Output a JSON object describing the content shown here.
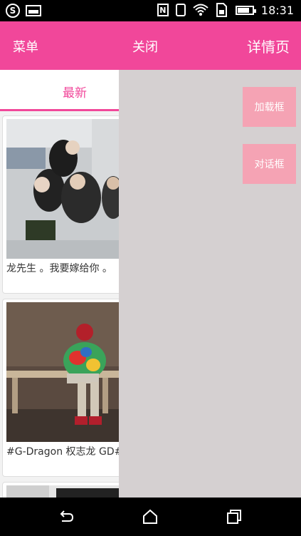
{
  "status_bar": {
    "time": "18:31",
    "s_label": "S",
    "nfc_label": "N"
  },
  "app_bar": {
    "menu": "菜单",
    "close": "关闭",
    "detail": "详情页",
    "color": "#f1479a"
  },
  "tabs": {
    "active": "最新"
  },
  "feed": {
    "items": [
      {
        "caption": "龙先生 。我要嫁给你 。"
      },
      {
        "caption": "#G-Dragon 权志龙 GD#"
      }
    ]
  },
  "drawer": {
    "buttons": [
      {
        "label": "加载框"
      },
      {
        "label": "对话框"
      }
    ],
    "button_color": "#f5a3b4"
  },
  "nav": {
    "back": "back-icon",
    "home": "home-icon",
    "recents": "recents-icon"
  }
}
